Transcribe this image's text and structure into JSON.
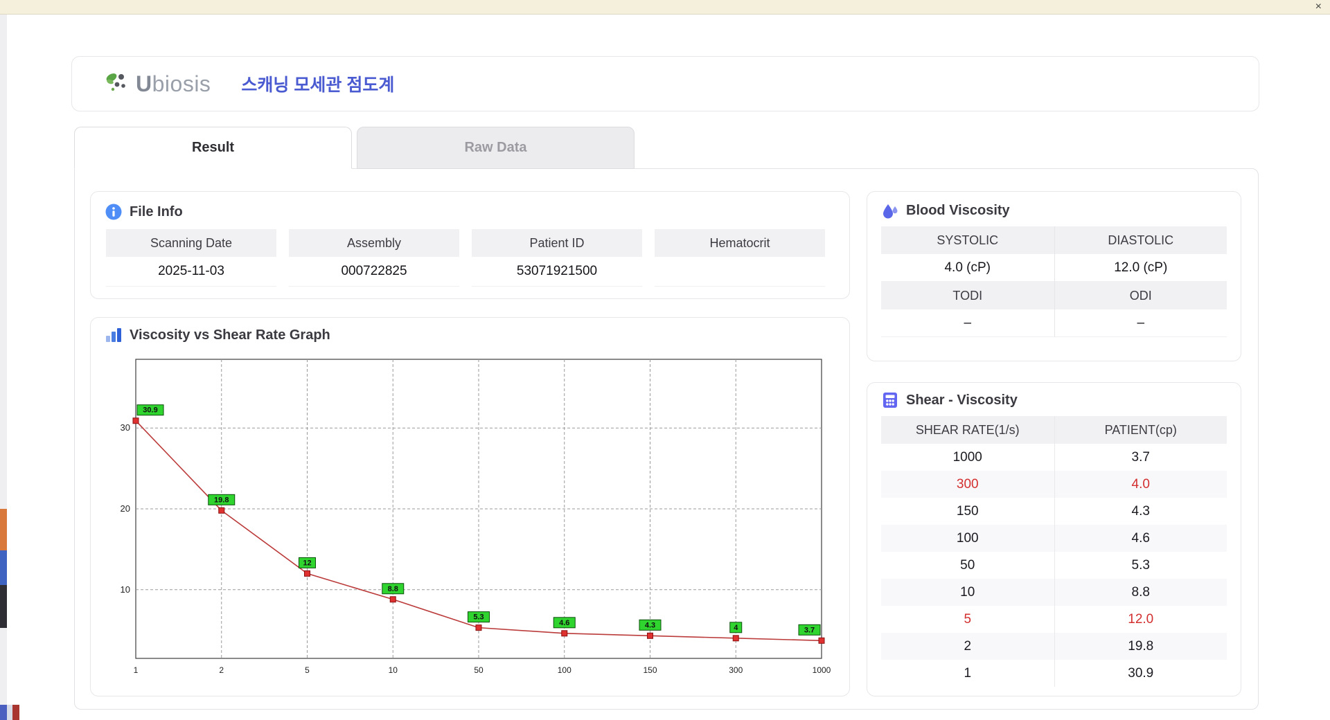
{
  "window": {
    "close_button": "×"
  },
  "header": {
    "logo_text": "biosis",
    "logo_initial": "U",
    "app_title": "스캐닝 모세관 점도계"
  },
  "tabs": {
    "result": "Result",
    "raw_data": "Raw Data"
  },
  "file_info": {
    "title": "File Info",
    "fields": [
      {
        "label": "Scanning Date",
        "value": "2025-11-03"
      },
      {
        "label": "Assembly",
        "value": "000722825"
      },
      {
        "label": "Patient ID",
        "value": "53071921500"
      },
      {
        "label": "Hematocrit",
        "value": ""
      }
    ]
  },
  "blood_viscosity": {
    "title": "Blood Viscosity",
    "systolic_label": "SYSTOLIC",
    "diastolic_label": "DIASTOLIC",
    "systolic_value": "4.0 (cP)",
    "diastolic_value": "12.0 (cP)",
    "todi_label": "TODI",
    "odi_label": "ODI",
    "todi_value": "–",
    "odi_value": "–"
  },
  "graph": {
    "title": "Viscosity vs Shear Rate Graph"
  },
  "shear_viscosity": {
    "title": "Shear - Viscosity",
    "columns": [
      "SHEAR RATE(1/s)",
      "PATIENT(cp)"
    ],
    "rows": [
      {
        "shear": "1000",
        "patient": "3.7",
        "highlight": false
      },
      {
        "shear": "300",
        "patient": "4.0",
        "highlight": true
      },
      {
        "shear": "150",
        "patient": "4.3",
        "highlight": false
      },
      {
        "shear": "100",
        "patient": "4.6",
        "highlight": false
      },
      {
        "shear": "50",
        "patient": "5.3",
        "highlight": false
      },
      {
        "shear": "10",
        "patient": "8.8",
        "highlight": false
      },
      {
        "shear": "5",
        "patient": "12.0",
        "highlight": true
      },
      {
        "shear": "2",
        "patient": "19.8",
        "highlight": false
      },
      {
        "shear": "1",
        "patient": "30.9",
        "highlight": false
      }
    ],
    "highlight_color": "#d32f2f"
  },
  "chart_data": {
    "type": "line",
    "title": "Viscosity vs Shear Rate Graph",
    "xlabel": "",
    "ylabel": "",
    "x": [
      1,
      2,
      5,
      10,
      50,
      100,
      150,
      300,
      1000
    ],
    "y": [
      30.9,
      19.8,
      12,
      8.8,
      5.3,
      4.6,
      4.3,
      4,
      3.7
    ],
    "point_labels": [
      "30.9",
      "19.8",
      "12",
      "8.8",
      "5.3",
      "4.6",
      "4.3",
      "4",
      "3.7"
    ],
    "x_tick_labels": [
      "1",
      "2",
      "5",
      "10",
      "50",
      "100",
      "150",
      "300",
      "1000"
    ],
    "y_ticks": [
      10,
      20,
      30
    ],
    "y_axis_min": 1.5,
    "y_axis_max": 38.5,
    "x_scale": "log-category",
    "grid": "dashed",
    "legend": "none",
    "line_color": "#bb3a3a",
    "point_color": "#e03131",
    "label_bg_color": "#2fd42f"
  },
  "colors": {
    "accent_blue": "#4a5ad0",
    "highlight_red": "#d32f2f"
  }
}
